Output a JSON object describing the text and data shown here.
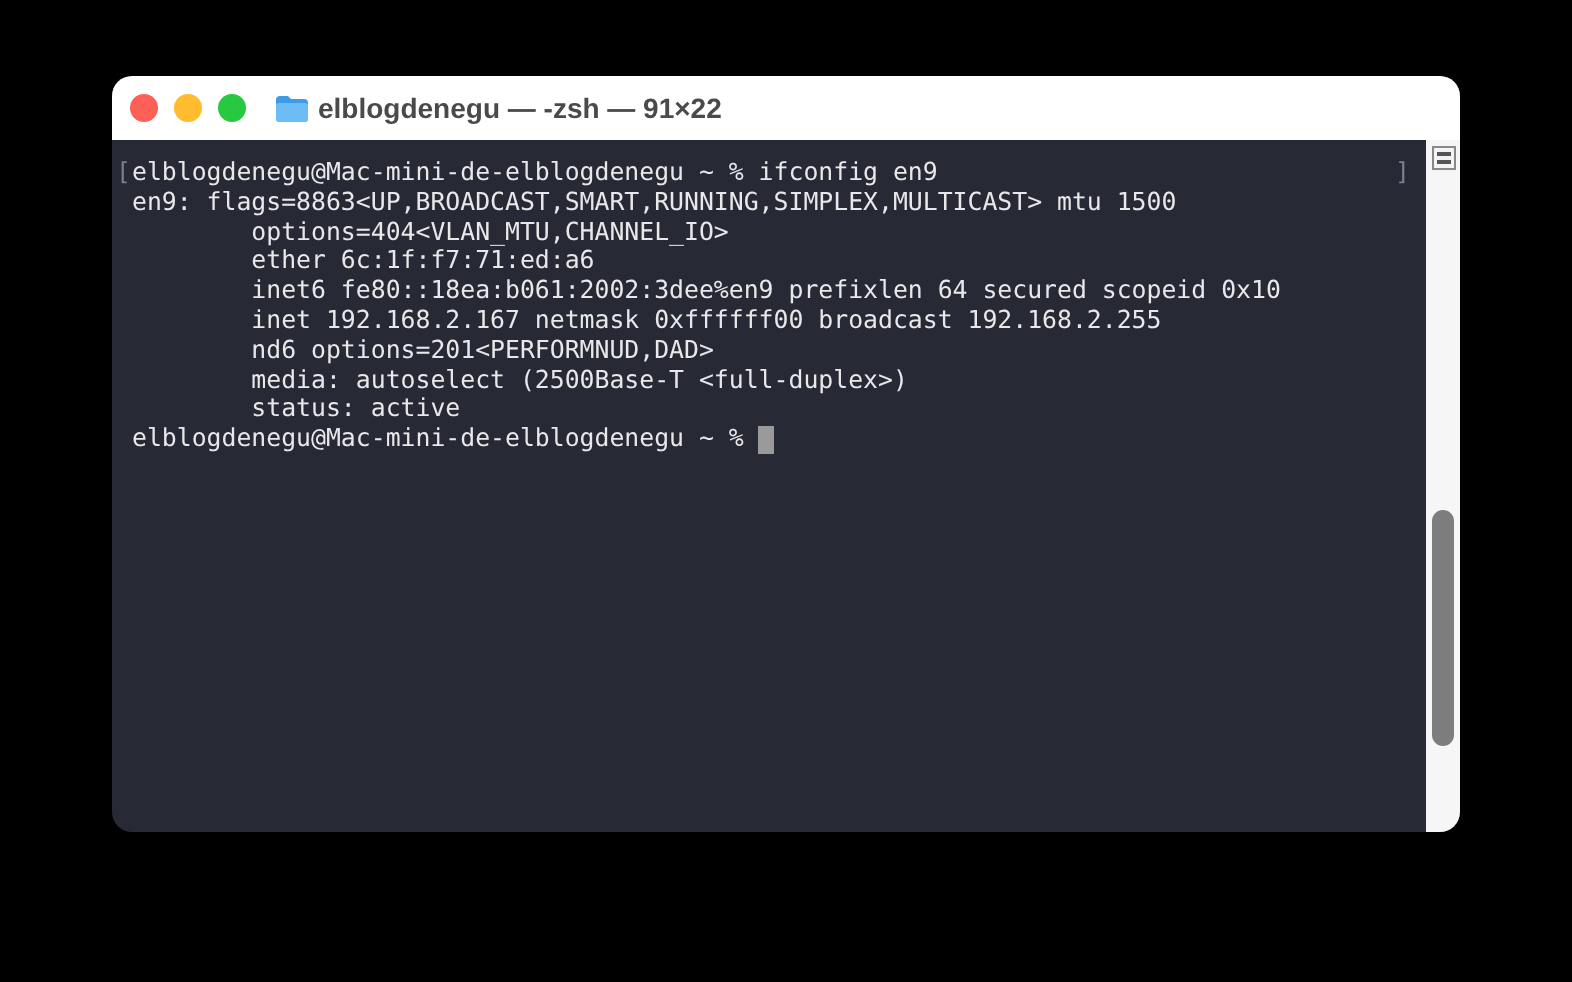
{
  "window": {
    "title": "elblogdenegu — -zsh — 91×22"
  },
  "terminal": {
    "mark_open": "[",
    "mark_close": "]",
    "cursor": true,
    "lines": [
      "elblogdenegu@Mac-mini-de-elblogdenegu ~ % ifconfig en9",
      "en9: flags=8863<UP,BROADCAST,SMART,RUNNING,SIMPLEX,MULTICAST> mtu 1500",
      "        options=404<VLAN_MTU,CHANNEL_IO>",
      "        ether 6c:1f:f7:71:ed:a6",
      "        inet6 fe80::18ea:b061:2002:3dee%en9 prefixlen 64 secured scopeid 0x10",
      "        inet 192.168.2.167 netmask 0xffffff00 broadcast 192.168.2.255",
      "        nd6 options=201<PERFORMNUD,DAD>",
      "        media: autoselect (2500Base-T <full-duplex>)",
      "        status: active",
      "elblogdenegu@Mac-mini-de-elblogdenegu ~ % "
    ]
  }
}
